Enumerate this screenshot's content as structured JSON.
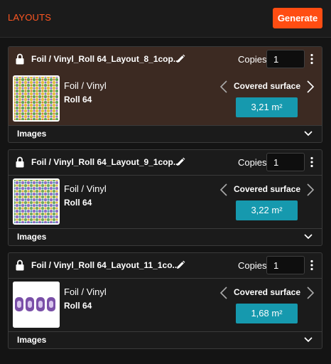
{
  "header": {
    "title": "LAYOUTS",
    "generate_label": "Generate"
  },
  "colors": {
    "accent": "#ff4d12",
    "active_card": "#3c2a22",
    "card": "#1b1b1b",
    "metric": "#1699ae",
    "background": "#141414"
  },
  "layouts": [
    {
      "name": "Foil / Vinyl_Roll 64_Layout_8_1cop...",
      "copies_label": "Copies",
      "copies_value": "1",
      "material": "Foil / Vinyl",
      "roll": "Roll 64",
      "metric_label": "Covered surface",
      "metric_value": "3,21 m²",
      "images_label": "Images",
      "selected": true,
      "thumbnail": "dense-multicolor-sticker-pattern"
    },
    {
      "name": "Foil / Vinyl_Roll 64_Layout_9_1cop...",
      "copies_label": "Copies",
      "copies_value": "1",
      "material": "Foil / Vinyl",
      "roll": "Roll 64",
      "metric_label": "Covered surface",
      "metric_value": "3,22 m²",
      "images_label": "Images",
      "selected": false,
      "thumbnail": "dense-multicolor-sticker-pattern"
    },
    {
      "name": "Foil / Vinyl_Roll 64_Layout_11_1co...",
      "copies_label": "Copies",
      "copies_value": "1",
      "material": "Foil / Vinyl",
      "roll": "Roll 64",
      "metric_label": "Covered surface",
      "metric_value": "1,68 m²",
      "images_label": "Images",
      "selected": false,
      "thumbnail": "four-purple-stickers-row"
    }
  ]
}
